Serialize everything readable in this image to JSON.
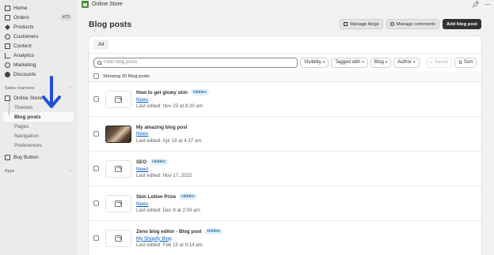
{
  "topbar": {
    "store_name": "Online Store",
    "icons": [
      "pin-icon",
      "more-icon"
    ]
  },
  "sidebar": {
    "items": [
      {
        "label": "Home",
        "icon": "home-icon"
      },
      {
        "label": "Orders",
        "icon": "orders-icon",
        "badge": "473"
      },
      {
        "label": "Products",
        "icon": "tag-icon"
      },
      {
        "label": "Customers",
        "icon": "person-icon"
      },
      {
        "label": "Content",
        "icon": "content-icon"
      },
      {
        "label": "Analytics",
        "icon": "analytics-icon"
      },
      {
        "label": "Marketing",
        "icon": "marketing-icon"
      },
      {
        "label": "Discounts",
        "icon": "discount-icon"
      }
    ],
    "sales_channels_label": "Sales channels",
    "online_store": {
      "label": "Online Store",
      "icon": "store-icon"
    },
    "sub_items": [
      "Themes",
      "Blog posts",
      "Pages",
      "Navigation",
      "Preferences"
    ],
    "active_sub": "Blog posts",
    "buy_button": {
      "label": "Buy Button",
      "icon": "buy-button-icon"
    },
    "apps_label": "Apps"
  },
  "page": {
    "title": "Blog posts",
    "buttons": {
      "manage_blogs": "Manage blogs",
      "manage_comments": "Manage comments",
      "add_blog_post": "Add blog post"
    }
  },
  "tabs": [
    "All"
  ],
  "filters": {
    "search_placeholder": "Filter blog posts",
    "visibility": "Visibility",
    "tagged_with": "Tagged with",
    "blog": "Blog",
    "author": "Author",
    "saved": "Saved",
    "sort": "Sort"
  },
  "selection": {
    "text": "Showing 20 Blog posts"
  },
  "posts": [
    {
      "title": "How to get glowy skin",
      "badge": "Hidden",
      "blog": "News",
      "edited": "Last edited: Nov 25 at 8:20 am",
      "thumb": "placeholder"
    },
    {
      "title": "My amazing blog post",
      "badge": "",
      "blog": "News",
      "edited": "Last edited: Apr 18 at 4:37 am",
      "thumb": "photo"
    },
    {
      "title": "SEO",
      "badge": "Hidden",
      "blog": "News",
      "edited": "Last edited: Nov 17, 2022",
      "thumb": "placeholder"
    },
    {
      "title": "Skin Lotion Prize",
      "badge": "Hidden",
      "blog": "News",
      "edited": "Last edited: Dec 8 at 2:59 am",
      "thumb": "placeholder"
    },
    {
      "title": "Zeno blog editor - Blog post",
      "badge": "Hidden",
      "blog": "My Shopify Blog",
      "edited": "Last edited: Feb 15 at 9:14 am",
      "thumb": "placeholder"
    }
  ],
  "colors": {
    "arrow": "#1f4fd6",
    "link": "#005bd3",
    "primary_button": "#303030"
  }
}
